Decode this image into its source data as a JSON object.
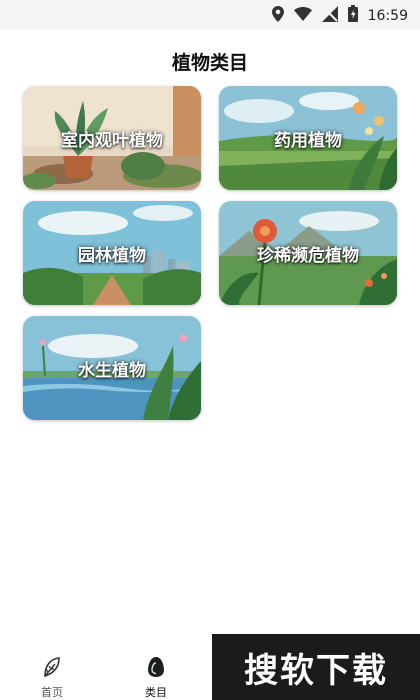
{
  "status_bar": {
    "time": "16:59"
  },
  "page": {
    "title": "植物类目"
  },
  "categories": [
    {
      "label": "室内观叶植物"
    },
    {
      "label": "药用植物"
    },
    {
      "label": "园林植物"
    },
    {
      "label": "珍稀濒危植物"
    },
    {
      "label": "水生植物"
    }
  ],
  "tabbar": {
    "home_label": "首页",
    "category_label": "类目"
  },
  "watermark": {
    "text": "搜软下载"
  }
}
